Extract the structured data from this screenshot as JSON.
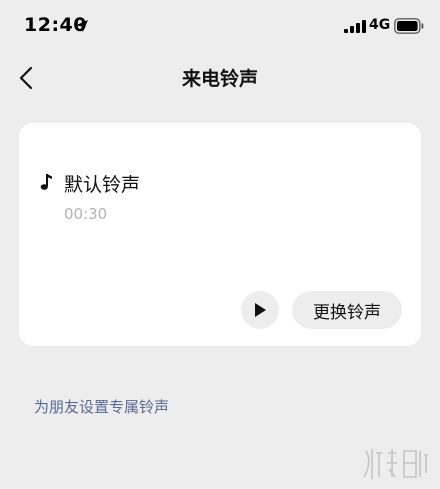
{
  "status_bar": {
    "time": "12:40",
    "network": "4G",
    "icons": [
      "location-arrow-icon",
      "cellular-signal-icon",
      "battery-icon"
    ]
  },
  "nav": {
    "title": "来电铃声",
    "back_icon": "chevron-left-icon"
  },
  "ringtone_card": {
    "icon": "music-note-icon",
    "name": "默认铃声",
    "duration": "00:30",
    "play_icon": "play-icon",
    "change_button_label": "更换铃声"
  },
  "friend_link": {
    "label": "为朋友设置专属铃声"
  },
  "watermark": {
    "text": "游侠网"
  },
  "colors": {
    "background": "#ededed",
    "card": "#ffffff",
    "link": "#576b95",
    "secondary_text": "#b3b3b3"
  }
}
